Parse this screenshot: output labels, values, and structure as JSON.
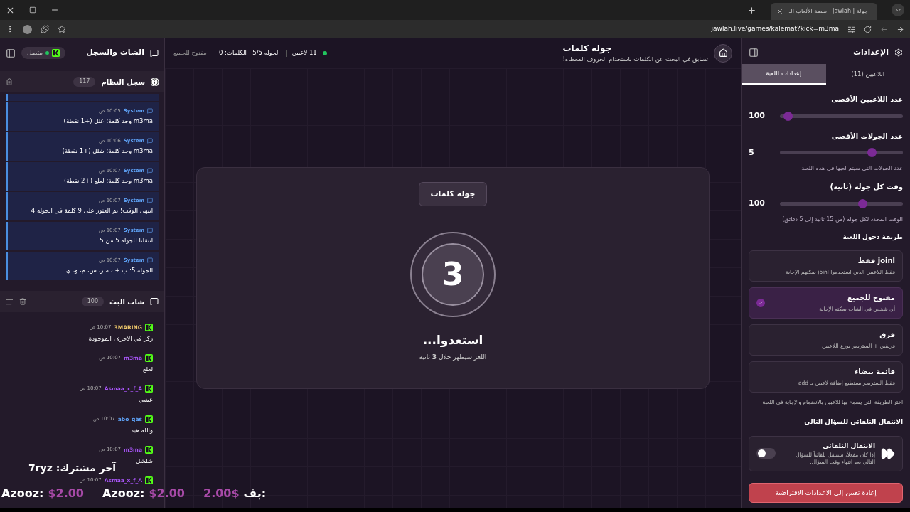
{
  "browser": {
    "tab_title": "جولة | Jawlah - منصة الألعاب الـ",
    "url": "jawlah.live/games/kalemat?kick=m3ma"
  },
  "chat_panel": {
    "title": "الشات والسجل",
    "status": "متصل",
    "log": {
      "title": "سجل النظام",
      "count": "117",
      "entries": [
        {
          "source": "System",
          "time": "10:05 ص",
          "text": "m3ma وجد كلمة: علل (+1 نقطة)"
        },
        {
          "source": "System",
          "time": "10:06 ص",
          "text": "m3ma وجد كلمة: شلل (+1 نقطة)"
        },
        {
          "source": "System",
          "time": "10:07 ص",
          "text": "m3ma وجد كلمة: لعلع (+2 نقطة)"
        },
        {
          "source": "System",
          "time": "10:07 ص",
          "text": "انتهى الوقت! تم العثور على 9 كلمة في الجوله 4"
        },
        {
          "source": "System",
          "time": "10:07 ص",
          "text": "انتقلنا للجوله 5 من 5"
        },
        {
          "source": "System",
          "time": "10:07 ص",
          "text": "الجوله 5: ب + ت، ز، س، م، و، ي"
        }
      ]
    },
    "stream_chat": {
      "title": "شات البث",
      "count": "100",
      "messages": [
        {
          "user": "3MARING",
          "color": "#e9c46a",
          "time": "10:07 ص",
          "text": "ركز في الاحرف الموجودة"
        },
        {
          "user": "m3ma",
          "color": "#a855f7",
          "time": "10:07 ص",
          "text": "لعلع"
        },
        {
          "user": "Asmaa_x_f_A",
          "color": "#a855f7",
          "time": "10:07 ص",
          "text": "عشي"
        },
        {
          "user": "abo_qas",
          "color": "#60a5fa",
          "time": "10:07 ص",
          "text": "والله هبد"
        },
        {
          "user": "m3ma",
          "color": "#a855f7",
          "time": "10:07 ص",
          "text": "شلشل"
        },
        {
          "user": "Asmaa_x_f_A",
          "color": "#a855f7",
          "time": "10:07 ص"
        }
      ]
    }
  },
  "game": {
    "title": "جوله كلمات",
    "subtitle": "تسابق في البحث عن الكلمات باستخدام الحروف المعطاة!",
    "players": "11 لاعبين",
    "round_info": "الجوله 5/5 - الكلمات: 0",
    "mode": "مفتوح للجميع",
    "card": {
      "badge": "جوله كلمات",
      "countdown": "3",
      "heading": "استعدوا...",
      "note": "اللغز سيظهر خلال **3** ثانية"
    }
  },
  "settings": {
    "title": "الإعدادات",
    "tabs": [
      {
        "label": "اللاعبين (11)",
        "selected": false
      },
      {
        "label": "إعدادات اللعبة",
        "selected": true
      }
    ],
    "sliders": [
      {
        "label": "عدد اللاعبين الأقصى",
        "value": "100",
        "level": 0.03
      },
      {
        "label": "عدد الجولات الأقصى",
        "value": "5",
        "level": 0.77,
        "hint": "عدد الجولات التي سيتم لعبها في هذه اللعبة"
      },
      {
        "label": "وقت كل جوله (ثانية)",
        "value": "100",
        "level": 0.69,
        "hint": "الوقت المحدد لكل جوله (من 15 ثانية إلى 5 دقائق)"
      }
    ],
    "entry": {
      "title": "طريقة دخول اللعبة",
      "options": [
        {
          "title": "joinl فقط",
          "desc": "فقط اللاعبين الذين استخدموا joinl يمكنهم الإجابة",
          "selected": false
        },
        {
          "title": "مفتوح للجميع",
          "desc": "أي شخص في الشات يمكنه الإجابة",
          "selected": true
        },
        {
          "title": "فرق",
          "desc": "فريقين + الستريمر يوزع اللاعبين",
          "selected": false
        },
        {
          "title": "قائمة بيضاء",
          "desc": "فقط الستريمر يستطيع إضافة لاعبين بـ add",
          "selected": false
        }
      ],
      "hint": "اختر الطريقة التي يسمح بها للاعبين بالانضمام والإجابة في اللعبة"
    },
    "auto_next": {
      "title": "الانتقال التلقائي للسؤال التالي",
      "card_title": "الانتقال التلقائي",
      "card_desc": "إذا كان مفعلاً، سينتقل تلقائياً للسؤال التالي بعد انتهاء وقت السؤال.",
      "on": false
    },
    "reset_button": "إعادة تعيين إلى الاعدادات الافتراضية"
  },
  "overlay": {
    "last_sub": "آخر مشترك: 7ryz",
    "donations": [
      {
        "kind": "amount_first",
        "name": "بف:",
        "amount": "2.00$"
      },
      {
        "kind": "name_first",
        "name": "Azooz:",
        "amount": "$2.00"
      },
      {
        "kind": "name_first",
        "name": "Azooz:",
        "amount": "$2.00"
      }
    ]
  }
}
